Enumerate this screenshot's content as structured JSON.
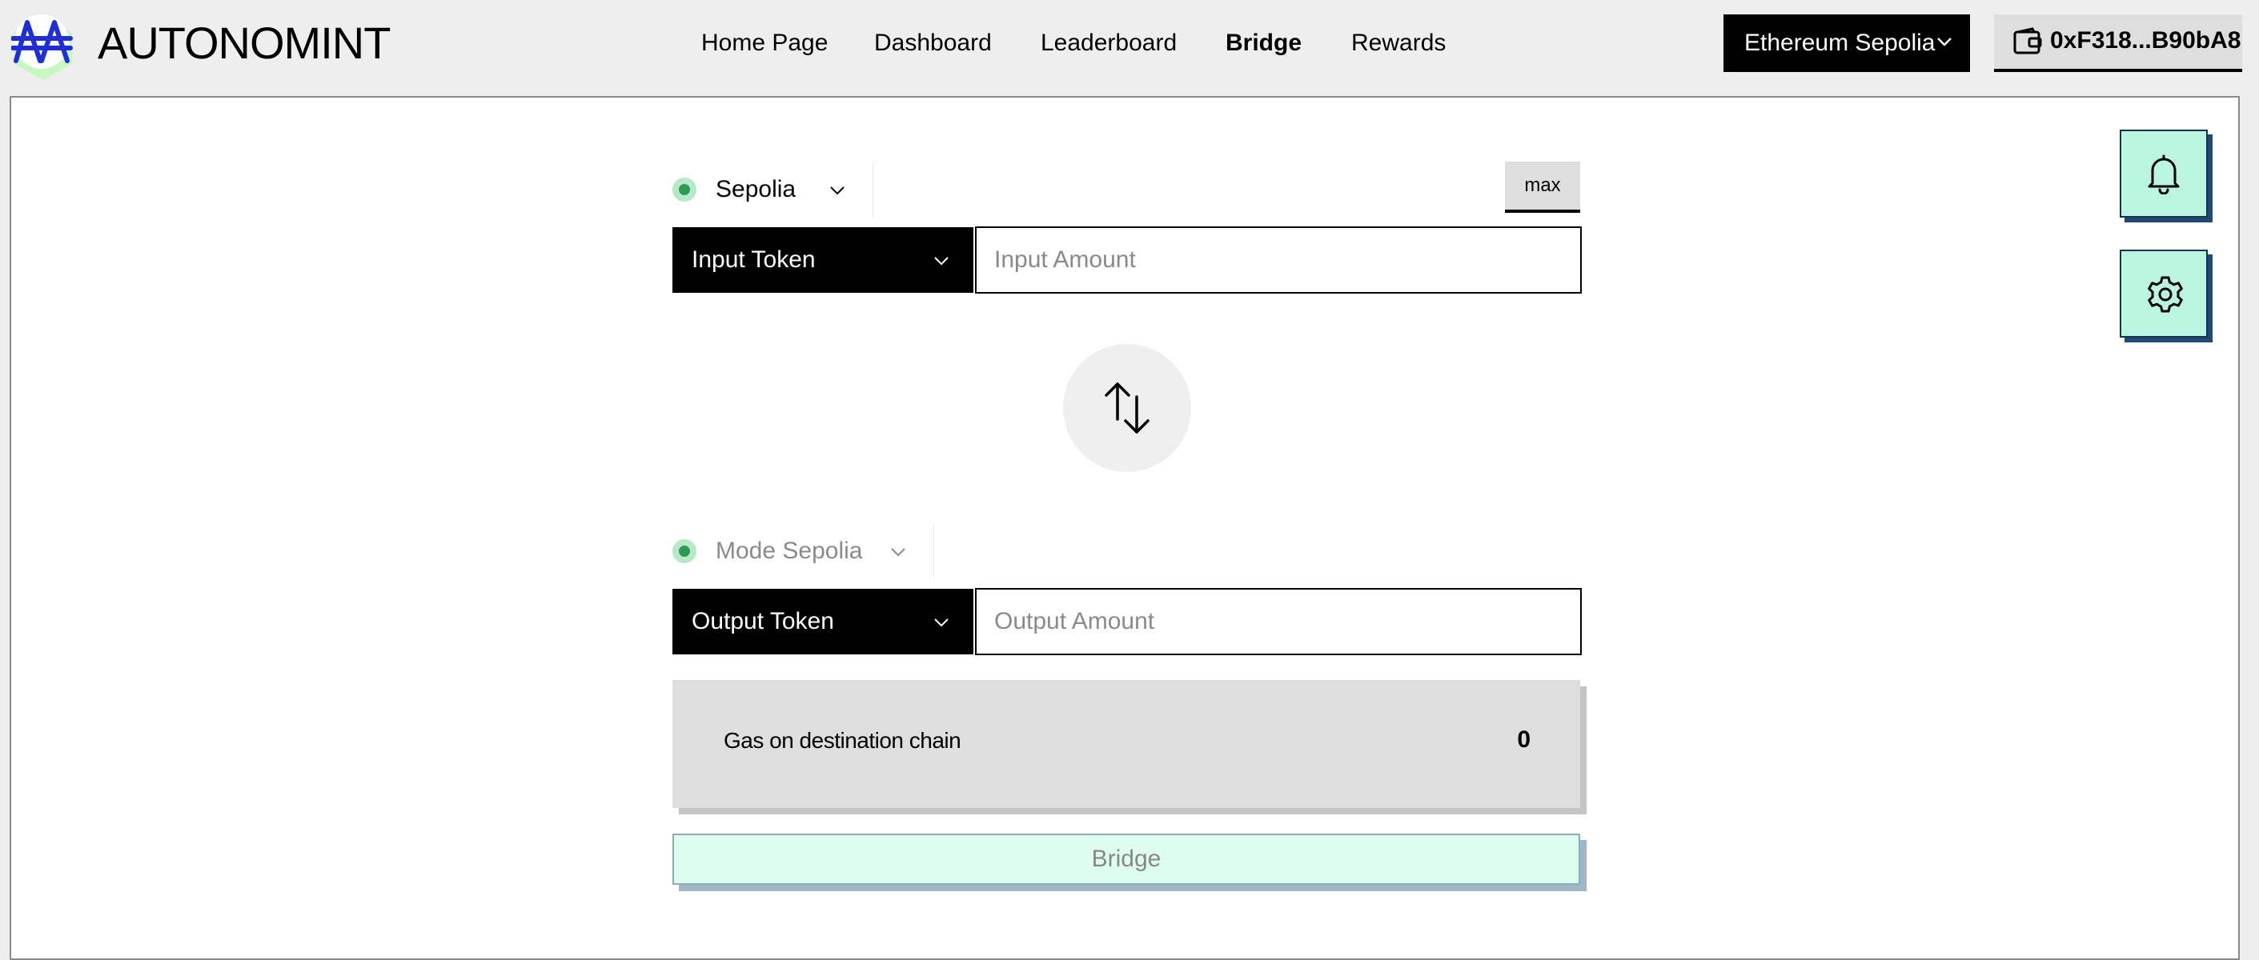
{
  "header": {
    "brand": "AUTONOMINT",
    "nav": [
      {
        "label": "Home Page",
        "active": false
      },
      {
        "label": "Dashboard",
        "active": false
      },
      {
        "label": "Leaderboard",
        "active": false
      },
      {
        "label": "Bridge",
        "active": true
      },
      {
        "label": "Rewards",
        "active": false
      }
    ],
    "network": "Ethereum Sepolia",
    "wallet": "0xF318...B90bA8"
  },
  "bridge": {
    "source_chain": "Sepolia",
    "max_label": "max",
    "input_token_label": "Input Token",
    "input_amount_placeholder": "Input Amount",
    "destination_chain": "Mode Sepolia",
    "output_token_label": "Output Token",
    "output_amount_placeholder": "Output Amount",
    "gas_label": "Gas on destination chain",
    "gas_value": "0",
    "submit_label": "Bridge"
  },
  "icons": {
    "logo": "autonomint-logo-icon",
    "wallet": "wallet-icon",
    "swap": "swap-arrows-icon",
    "notifications": "bell-icon",
    "settings": "gear-icon"
  },
  "colors": {
    "accent_mint": "#ddfdee",
    "side_button": "#b9f5df",
    "status_green": "#2f9a55"
  }
}
